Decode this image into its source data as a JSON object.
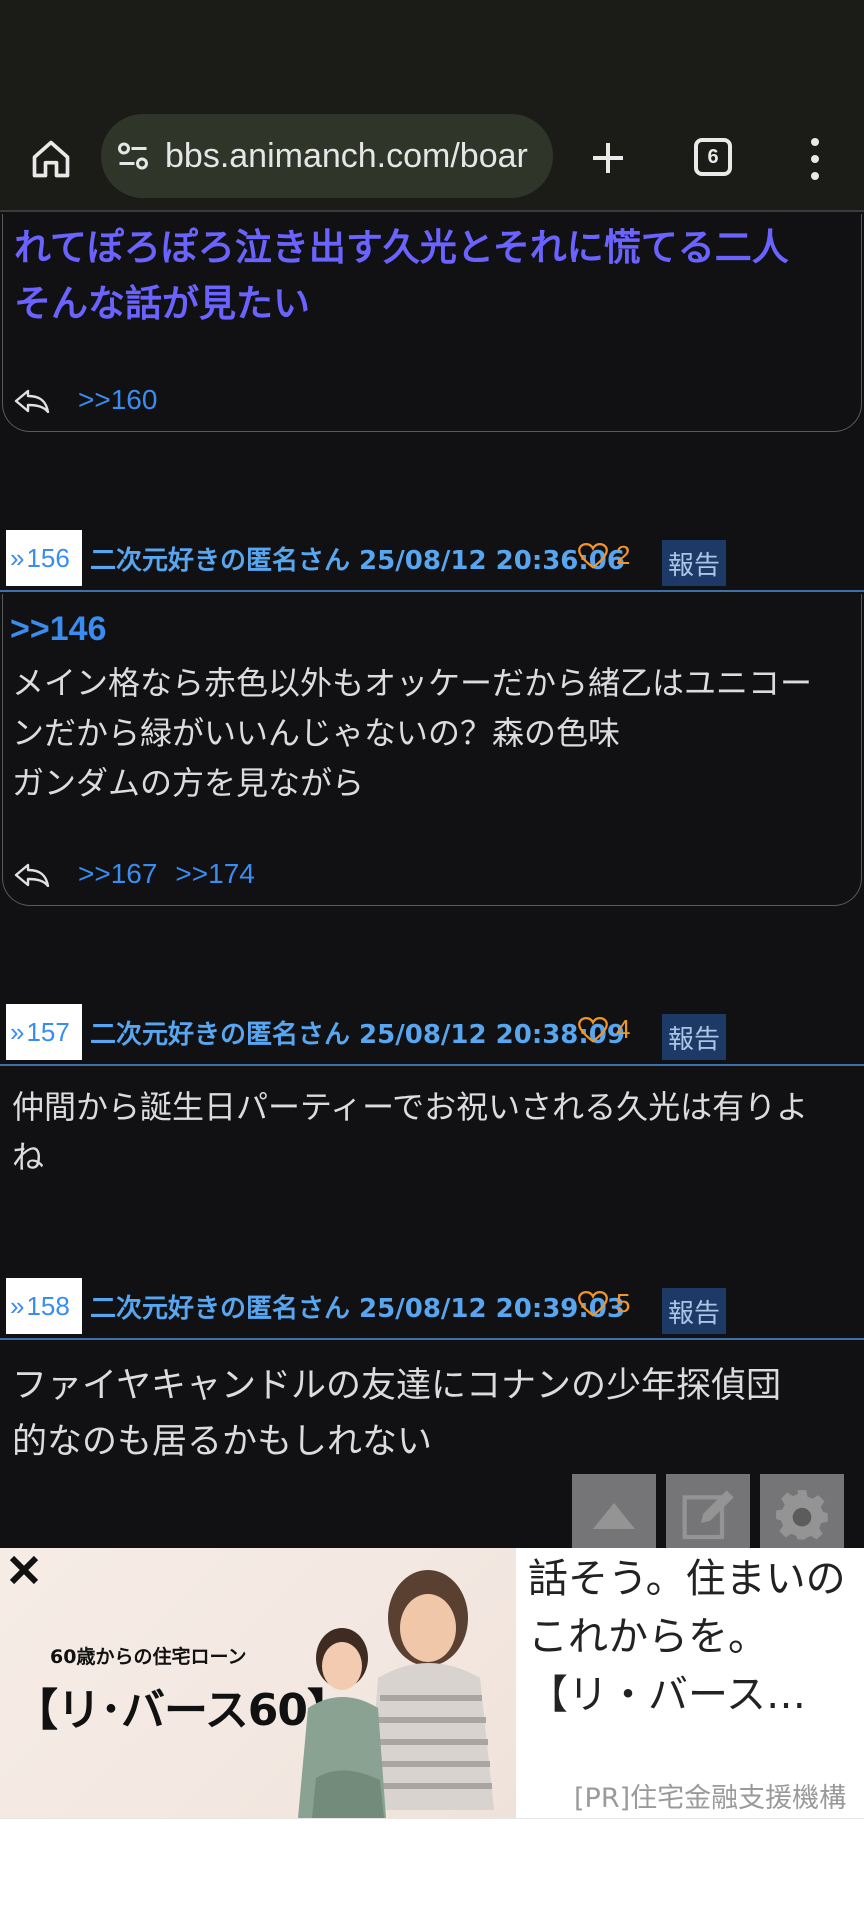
{
  "browser": {
    "url": "bbs.animanch.com/boar",
    "tab_count": "6"
  },
  "posts": {
    "top": {
      "text_lines": [
        "れてぽろぽろ泣き出す久光とそれに慌てる二人",
        "そんな話が見たい"
      ],
      "replies": [
        ">>160"
      ]
    },
    "p156": {
      "number": "156",
      "author_time": "二次元好きの匿名さん 25/08/12 20:36:06",
      "likes": "2",
      "report": "報告",
      "anchor": ">>146",
      "text_lines": [
        "メイン格なら赤色以外もオッケーだから緒乙はユニコー",
        "ンだから緑がいいんじゃないの？森の色味",
        "ガンダムの方を見ながら"
      ],
      "replies": [
        ">>167",
        ">>174"
      ]
    },
    "p157": {
      "number": "157",
      "author_time": "二次元好きの匿名さん 25/08/12 20:38:09",
      "likes": "4",
      "report": "報告",
      "text_lines": [
        "仲間から誕生日パーティーでお祝いされる久光は有りよ",
        "ね"
      ]
    },
    "p158": {
      "number": "158",
      "author_time": "二次元好きの匿名さん 25/08/12 20:39:03",
      "likes": "5",
      "report": "報告",
      "text_lines": [
        "ファイヤキャンドルの友達にコナンの少年探偵団",
        "的なのも居るかもしれない"
      ]
    }
  },
  "ad": {
    "subtitle": "60歳からの住宅ローン",
    "brand": "【リ･バース60】",
    "headline": "話そう。住まいのこれからを。【リ・バース…",
    "sponsor": "[PR]住宅金融支援機構"
  },
  "colors": {
    "accent_blue": "#3a8df0",
    "purple_text": "#6b63ff",
    "like_orange": "#f0952a"
  }
}
